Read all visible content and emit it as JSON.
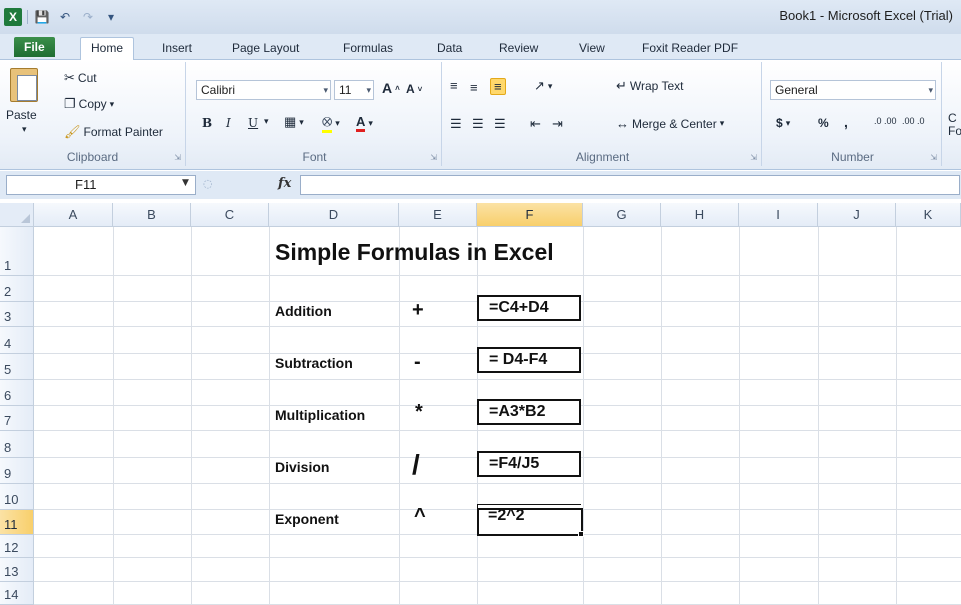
{
  "window": {
    "title": "Book1 - Microsoft Excel (Trial)",
    "qat_icons": [
      "excel-logo",
      "save-icon",
      "undo-icon",
      "redo-icon",
      "customize-icon"
    ]
  },
  "tabs": [
    "File",
    "Home",
    "Insert",
    "Page Layout",
    "Formulas",
    "Data",
    "Review",
    "View",
    "Foxit Reader PDF"
  ],
  "active_tab": "Home",
  "ribbon": {
    "clipboard": {
      "label": "Clipboard",
      "paste": "Paste",
      "cut": "Cut",
      "copy": "Copy",
      "format_painter": "Format Painter"
    },
    "font": {
      "label": "Font",
      "name": "Calibri",
      "size": "11",
      "bold": "B",
      "italic": "I",
      "underline": "U"
    },
    "alignment": {
      "label": "Alignment",
      "wrap_text": "Wrap Text",
      "merge_center": "Merge & Center"
    },
    "number": {
      "label": "Number",
      "format": "General",
      "currency": "$",
      "percent": "%",
      "comma": ",",
      "inc_decimal": ".0 .00",
      "dec_decimal": ".00 .0"
    },
    "styles_partial": {
      "line1": "C",
      "line2": "Fo"
    }
  },
  "formula_bar": {
    "name_box": "F11",
    "fx": "fx",
    "value": ""
  },
  "grid": {
    "columns": [
      "A",
      "B",
      "C",
      "D",
      "E",
      "F",
      "G",
      "H",
      "I",
      "J",
      "K"
    ],
    "selected_column": "F",
    "rows": [
      "1",
      "2",
      "3",
      "4",
      "5",
      "6",
      "7",
      "8",
      "9",
      "10",
      "11",
      "12",
      "13",
      "14"
    ],
    "selected_row": "11"
  },
  "sheet": {
    "title": "Simple Formulas in Excel",
    "operations": [
      {
        "label": "Addition",
        "symbol": "+",
        "formula": "=C4+D4"
      },
      {
        "label": "Subtraction",
        "symbol": "-",
        "formula": "= D4-F4"
      },
      {
        "label": "Multiplication",
        "symbol": "*",
        "formula": "=A3*B2"
      },
      {
        "label": "Division",
        "symbol": "/",
        "formula": "=F4/J5"
      },
      {
        "label": "Exponent",
        "symbol": "^",
        "formula": "=2^2"
      }
    ]
  },
  "colors": {
    "selected_header": "#f8cf6b",
    "file_tab": "#2b7d3d",
    "ribbon_bg": "#eef3fa"
  }
}
